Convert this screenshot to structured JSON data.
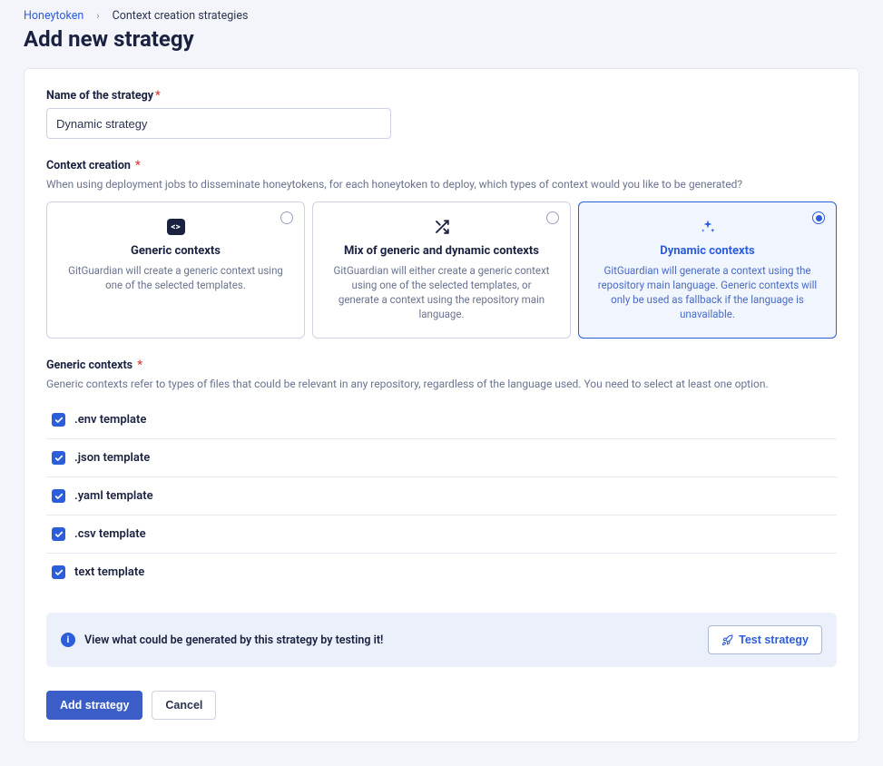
{
  "breadcrumb": {
    "root": "Honeytoken",
    "current": "Context creation strategies"
  },
  "title": "Add new strategy",
  "name_field": {
    "label": "Name of the strategy",
    "value": "Dynamic strategy"
  },
  "context_creation": {
    "label": "Context creation",
    "help": "When using deployment jobs to disseminate honeytokens, for each honeytoken to deploy, which types of context would you like to be generated?",
    "options": [
      {
        "title": "Generic contexts",
        "desc": "GitGuardian will create a generic context using one of the selected templates."
      },
      {
        "title": "Mix of generic and dynamic contexts",
        "desc": "GitGuardian will either create a generic context using one of the selected templates, or generate a context using the repository main language."
      },
      {
        "title": "Dynamic contexts",
        "desc": "GitGuardian will generate a context using the repository main language. Generic contexts will only be used as fallback if the language is unavailable."
      }
    ]
  },
  "generic_contexts": {
    "label": "Generic contexts",
    "help": "Generic contexts refer to types of files that could be relevant in any repository, regardless of the language used. You need to select at least one option.",
    "items": [
      ".env template",
      ".json template",
      ".yaml template",
      ".csv template",
      "text template"
    ]
  },
  "callout": {
    "text": "View what could be generated by this strategy by testing it!",
    "button": "Test strategy"
  },
  "footer": {
    "primary": "Add strategy",
    "cancel": "Cancel"
  }
}
